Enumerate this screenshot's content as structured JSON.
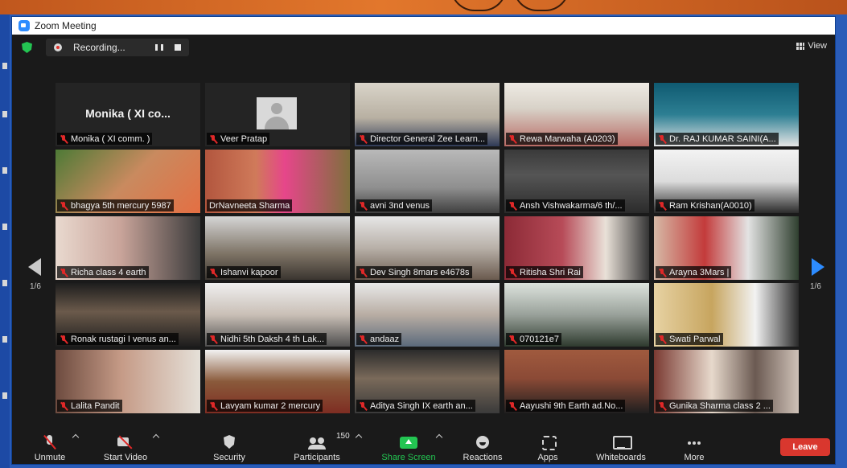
{
  "window": {
    "title": "Zoom Meeting"
  },
  "topbar": {
    "recording_label": "Recording...",
    "view_label": "View"
  },
  "gallery": {
    "page_left": "1/6",
    "page_right": "1/6",
    "tiles": [
      {
        "name": "Monika ( XI comm. )",
        "big_name": "Monika ( XI co...",
        "kind": "name",
        "bg": "#242424"
      },
      {
        "name": "Veer Pratap",
        "kind": "avatar",
        "bg": "#242424"
      },
      {
        "name": "Director General Zee Learn...",
        "kind": "video",
        "bg": "linear-gradient(180deg,#d9d4c9 0%,#b8b0a2 55%,#2f3a57 100%)"
      },
      {
        "name": "Rewa Marwaha (A0203)",
        "kind": "video",
        "bg": "linear-gradient(180deg,#eeeae3 0%,#d8d2c8 40%,#b86a64 100%)"
      },
      {
        "name": "Dr. RAJ KUMAR SAINI(A...",
        "kind": "video",
        "bg": "linear-gradient(180deg,#0f5a71 0%,#2d7f93 50%,#e6e6e6 100%)"
      },
      {
        "name": "bhagya 5th mercury 5987",
        "kind": "video",
        "bg": "linear-gradient(135deg,#4d7a36 0%,#c98a5f 50%,#e46f43 100%)"
      },
      {
        "name": "DrNavneeta Sharma",
        "kind": "video",
        "bg": "linear-gradient(90deg,#b2563e 0%,#d07a5a 35%,#e6468a 55%,#7f6f3d 100%)",
        "active": true
      },
      {
        "name": "avni 3nd venus",
        "kind": "video",
        "bg": "linear-gradient(180deg,#b9b9b9 0%,#8f8f8f 60%,#3f3f3f 100%)"
      },
      {
        "name": "Ansh Vishwakarma/6 th/...",
        "kind": "video",
        "bg": "linear-gradient(180deg,#3a3a3a 0%,#555 40%,#2b2b2b 100%)"
      },
      {
        "name": "Ram Krishan(A0010)",
        "kind": "video",
        "bg": "linear-gradient(180deg,#f3f3f3 0%,#dcdcdc 50%,#2b2b2b 100%)"
      },
      {
        "name": "Richa  class 4 earth",
        "kind": "video",
        "bg": "linear-gradient(90deg,#e9d9cf 0%,#c9a49a 45%,#3a3a3a 100%)"
      },
      {
        "name": "Ishanvi kapoor",
        "kind": "video",
        "bg": "linear-gradient(180deg,#d5d5d5 0%,#7c7264 60%,#3b3530 100%)"
      },
      {
        "name": "Dev Singh 8mars e4678s",
        "kind": "video",
        "bg": "linear-gradient(180deg,#e6e6e6 0%,#b8b0a8 50%,#6a5a4e 100%)"
      },
      {
        "name": "Ritisha Shri Rai",
        "kind": "video",
        "bg": "linear-gradient(90deg,#8c2a36 0%,#b74b58 40%,#e9e1d8 70%,#353535 100%)"
      },
      {
        "name": "Arayna 3Mars |",
        "kind": "video",
        "bg": "linear-gradient(90deg,#d6b9a6 0%,#c33b3b 35%,#e3e3e3 65%,#2f3f2f 100%)"
      },
      {
        "name": "Ronak rustagi I venus an...",
        "kind": "video",
        "bg": "linear-gradient(180deg,#1d1d1d 0%,#6b5a4b 45%,#1d1d1d 100%)"
      },
      {
        "name": "Nidhi 5th Daksh 4 th Lak...",
        "kind": "video",
        "bg": "linear-gradient(180deg,#efefef 0%,#c9bfb6 50%,#4e4e4e 100%)"
      },
      {
        "name": "andaaz",
        "kind": "video",
        "bg": "linear-gradient(180deg,#e8e8e8 0%,#b8ada3 50%,#5b6a7c 100%)"
      },
      {
        "name": "070121e7",
        "kind": "video",
        "bg": "linear-gradient(180deg,#dde3dd 0%,#99a19a 50%,#2e3a2e 100%)"
      },
      {
        "name": "Swati Parwal",
        "kind": "video",
        "bg": "linear-gradient(90deg,#e7d2a3 0%,#c7a55f 40%,#f2f2f2 70%,#2a2a2a 100%)"
      },
      {
        "name": "Lalita Pandit",
        "kind": "video",
        "bg": "linear-gradient(90deg,#6d4b3f 0%,#c59a86 45%,#e5e0d8 100%)"
      },
      {
        "name": "Lavyam kumar 2 mercury",
        "kind": "video",
        "bg": "linear-gradient(180deg,#f2f2f2 0%,#8a5a3b 50%,#7e2d22 100%)"
      },
      {
        "name": "Aditya Singh IX earth an...",
        "kind": "video",
        "bg": "linear-gradient(180deg,#2b2b2b 0%,#7a6a5a 45%,#3a3a3a 100%)"
      },
      {
        "name": "Aayushi 9th Earth ad.No...",
        "kind": "video",
        "bg": "linear-gradient(180deg,#a05a3e 0%,#8b4a36 45%,#1f1f1f 100%)"
      },
      {
        "name": "Gunika Sharma class 2 ...",
        "kind": "video",
        "bg": "linear-gradient(90deg,#7a3a32 0%,#e7d9cc 40%,#6b5a52 70%,#cfc2b8 100%)"
      }
    ]
  },
  "toolbar": {
    "unmute": "Unmute",
    "start_video": "Start Video",
    "security": "Security",
    "participants": "Participants",
    "participants_count": "150",
    "share_screen": "Share Screen",
    "reactions": "Reactions",
    "apps": "Apps",
    "whiteboards": "Whiteboards",
    "more": "More",
    "leave": "Leave"
  },
  "colors": {
    "accent": "#2d8cff",
    "share_green": "#23c552",
    "leave_red": "#d9372e",
    "active_border": "#d8d34a"
  },
  "icons": [
    "shield-icon",
    "record-icon",
    "pause-icon",
    "stop-icon",
    "grid-icon",
    "mic-off-icon",
    "video-off-icon",
    "security-icon",
    "participants-icon",
    "share-screen-icon",
    "reactions-icon",
    "apps-icon",
    "whiteboard-icon",
    "more-icon"
  ]
}
